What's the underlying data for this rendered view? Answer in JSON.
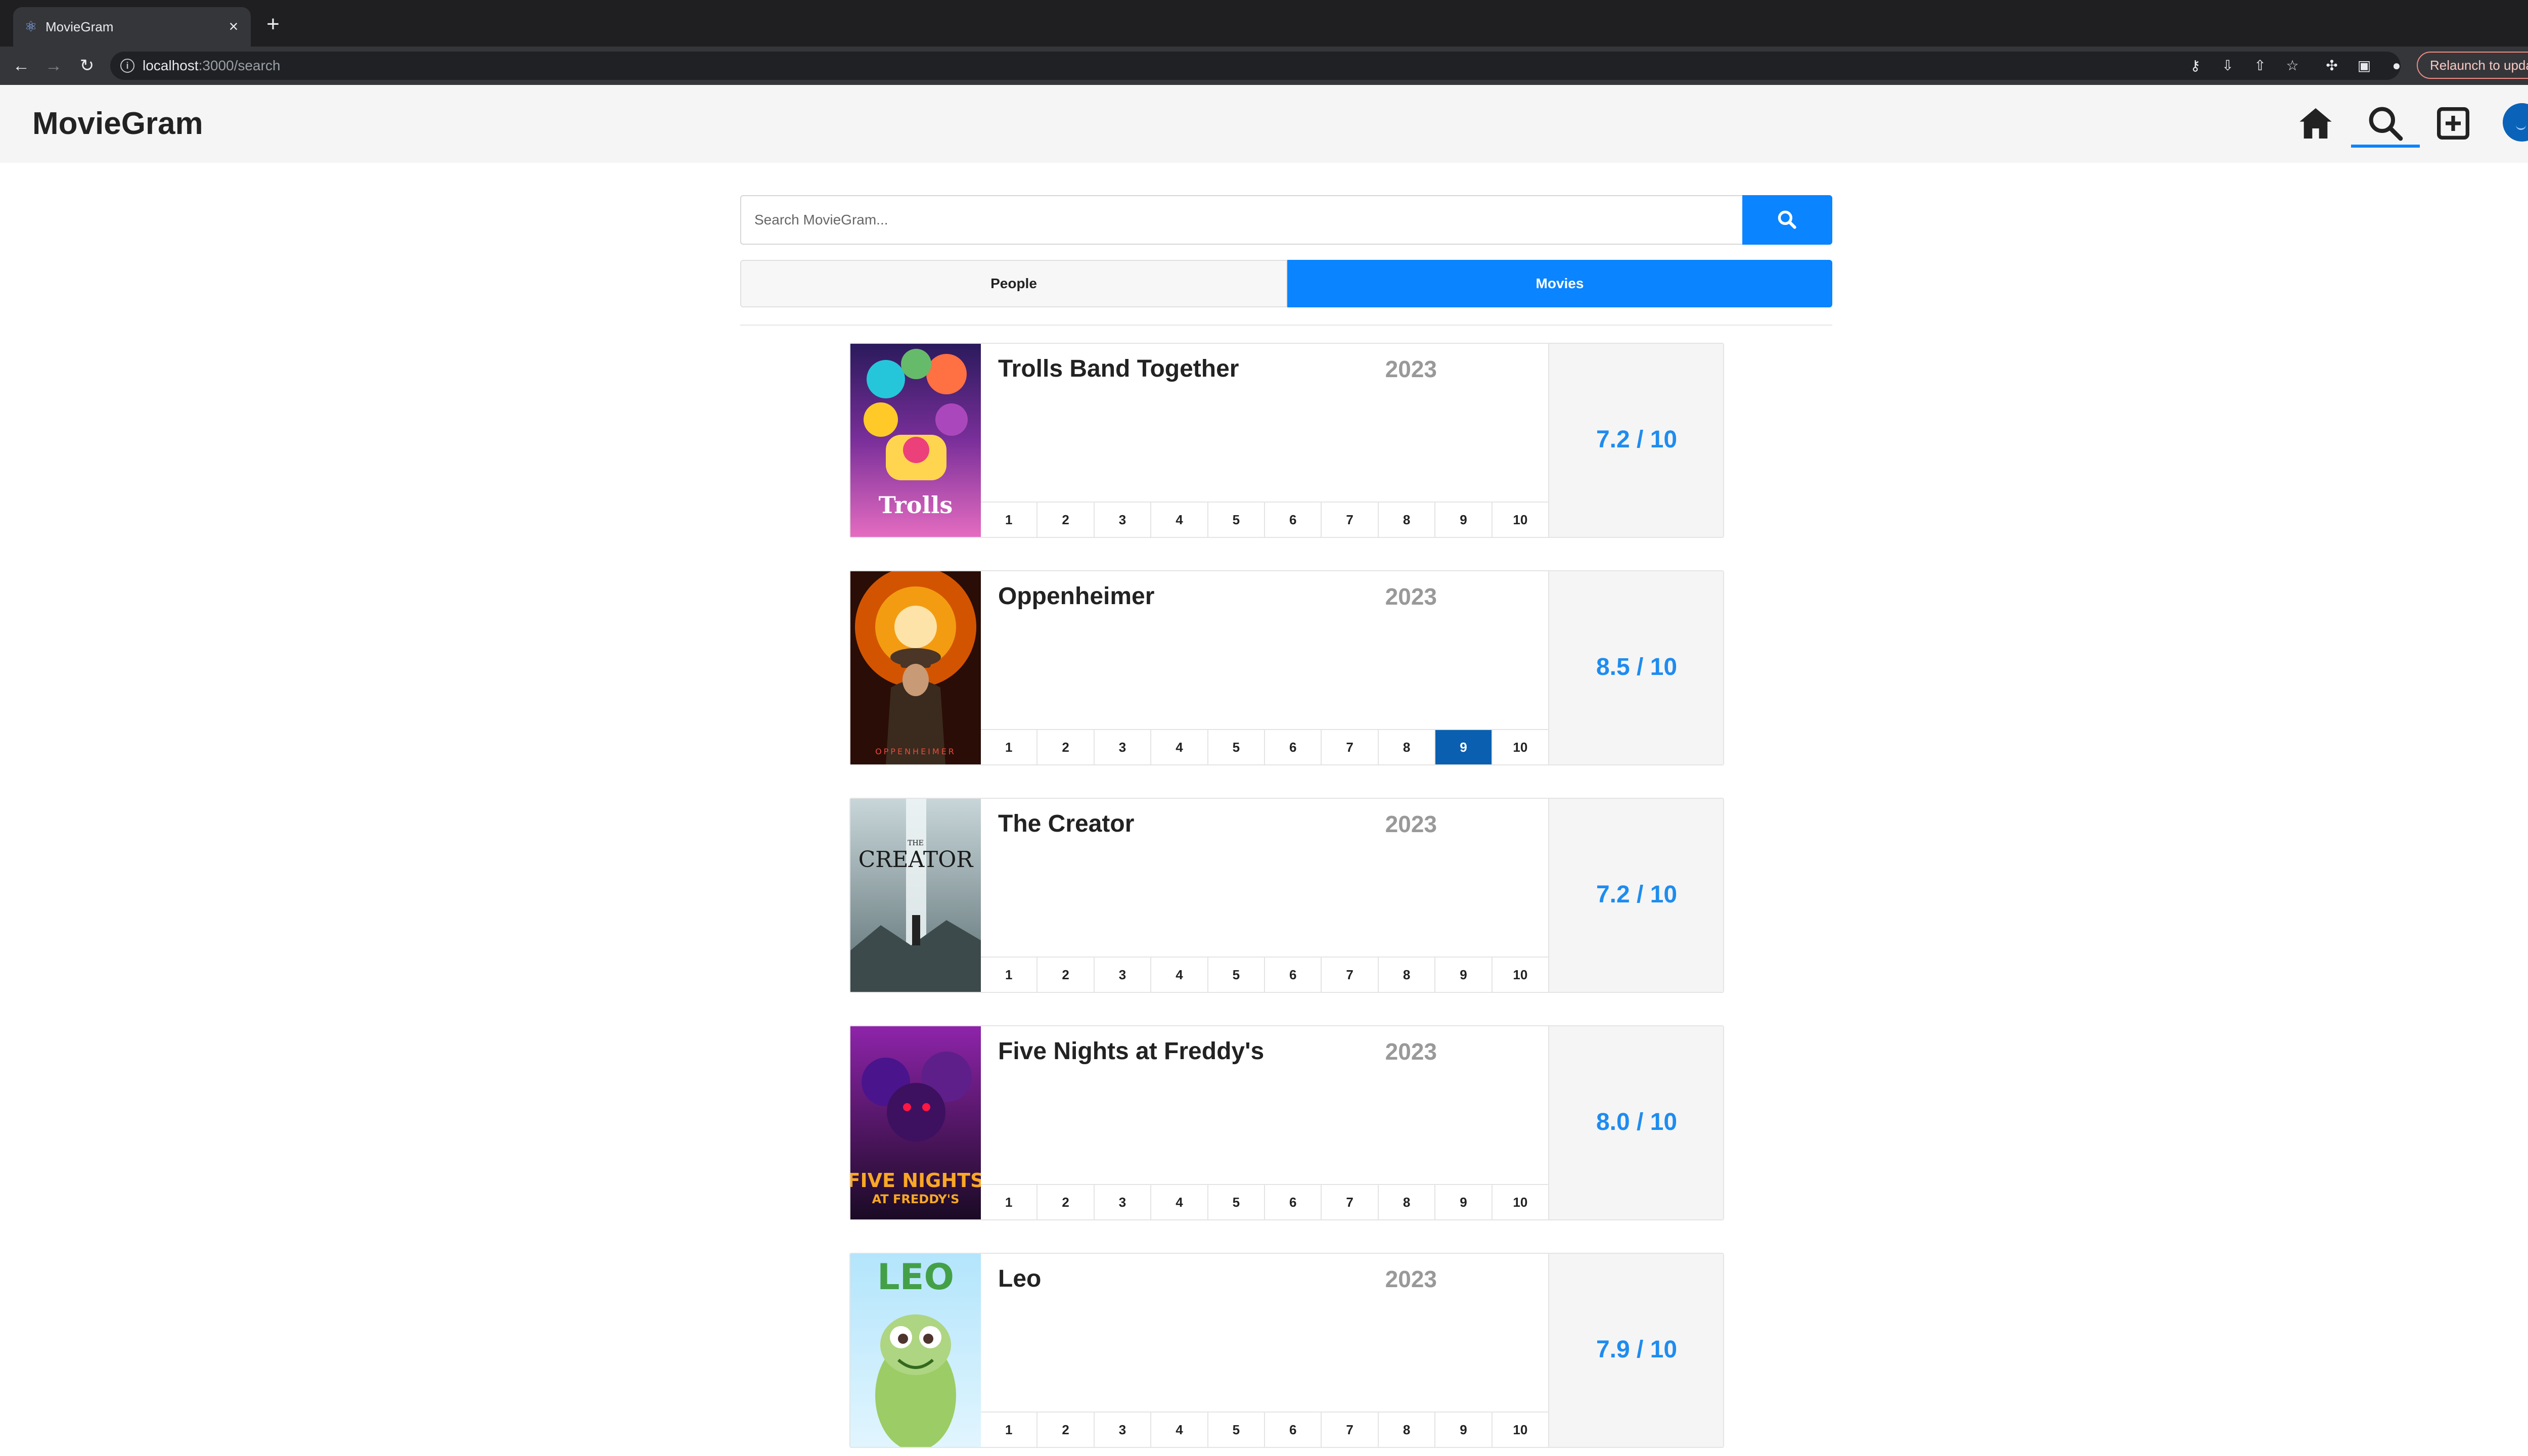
{
  "browser": {
    "tab_title": "MovieGram",
    "url_host": "localhost",
    "url_rest": ":3000/search",
    "relaunch_label": "Relaunch to update"
  },
  "app": {
    "logo": "MovieGram",
    "search_placeholder": "Search MovieGram...",
    "segments": {
      "people": "People",
      "movies": "Movies",
      "active": "Movies"
    }
  },
  "colors": {
    "accent": "#0a84ff",
    "selected_rating": "#0a5fb0",
    "score": "#1e8cf0"
  },
  "rating_scale": [
    "1",
    "2",
    "3",
    "4",
    "5",
    "6",
    "7",
    "8",
    "9",
    "10"
  ],
  "movies": [
    {
      "title": "Trolls Band Together",
      "year": "2023",
      "score": "7.2 / 10",
      "user_rating": null,
      "poster_text": "Trolls"
    },
    {
      "title": "Oppenheimer",
      "year": "2023",
      "score": "8.5 / 10",
      "user_rating": "9",
      "poster_text": "OPPENHEIMER"
    },
    {
      "title": "The Creator",
      "year": "2023",
      "score": "7.2 / 10",
      "user_rating": null,
      "poster_text": "THE CREATOR"
    },
    {
      "title": "Five Nights at Freddy's",
      "year": "2023",
      "score": "8.0 / 10",
      "user_rating": null,
      "poster_text": "FIVE NIGHTS AT FREDDY'S"
    },
    {
      "title": "Leo",
      "year": "2023",
      "score": "7.9 / 10",
      "user_rating": null,
      "poster_text": "LEO"
    }
  ]
}
